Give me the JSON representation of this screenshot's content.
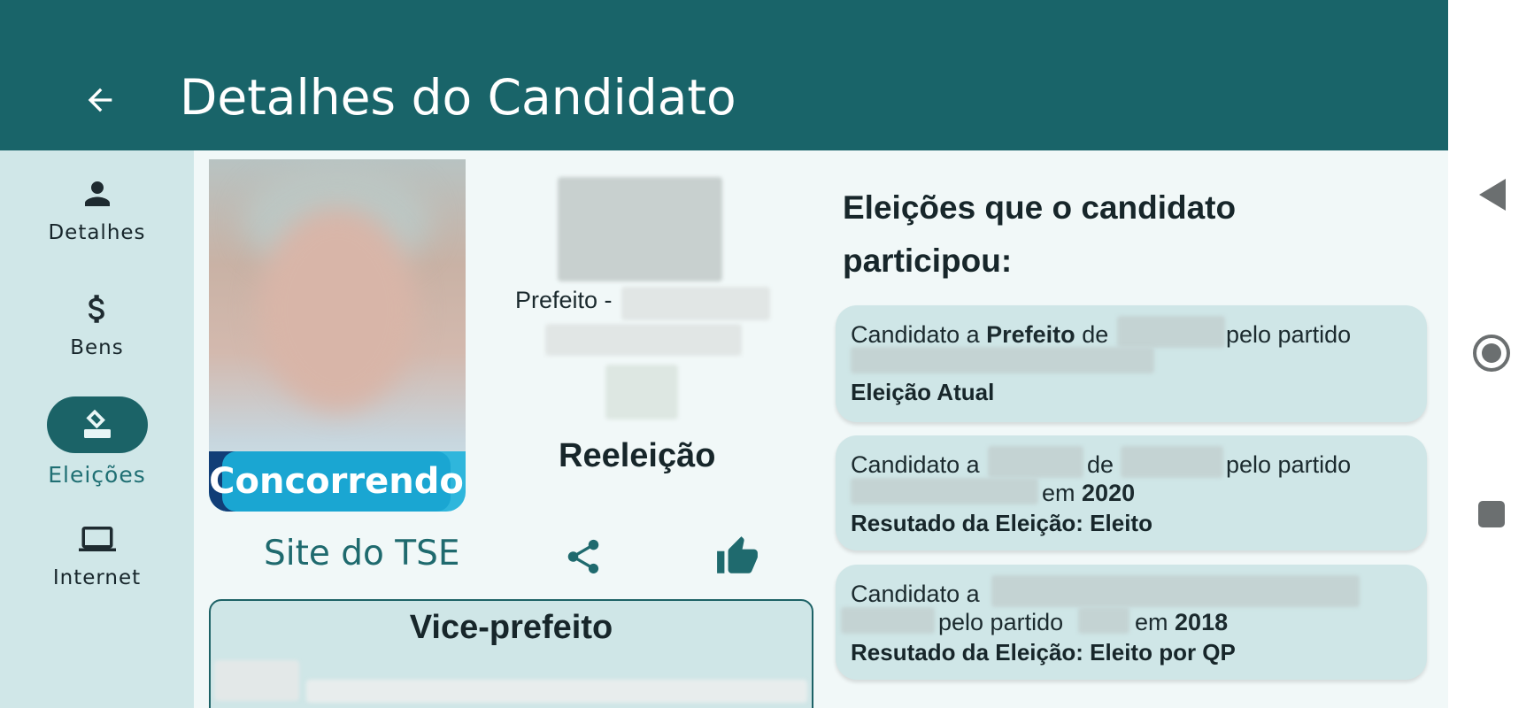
{
  "app_bar": {
    "title": "Detalhes do Candidato",
    "back_icon": "arrow-left-icon",
    "background": "#196469"
  },
  "nav_rail": {
    "items": [
      {
        "label": "Detalhes",
        "icon": "person-icon",
        "active": false
      },
      {
        "label": "Bens",
        "icon": "dollar-icon",
        "active": false
      },
      {
        "label": "Eleições",
        "icon": "ballot-box-icon",
        "active": true
      },
      {
        "label": "Internet",
        "icon": "laptop-icon",
        "active": false
      }
    ]
  },
  "candidate": {
    "status_badge": "Concorrendo",
    "office_prefix": "Prefeito -",
    "reelection": "Reeleição",
    "site_link": "Site do TSE",
    "share_icon": "share-icon",
    "like_icon": "thumbs-up-icon",
    "vice_title": "Vice-prefeito"
  },
  "elections": {
    "heading": "Eleições que o candidato participou:",
    "cards": [
      {
        "l1_pre": "Candidato a",
        "l1_office": "Prefeito",
        "l1_mid": "de",
        "l1_post": "pelo partido",
        "status": "Eleição Atual"
      },
      {
        "l1_pre": "Candidato a",
        "l1_mid": "de",
        "l1_post": "pelo partido",
        "l2_em": "em",
        "year": "2020",
        "result": "Resutado da Eleição: Eleito"
      },
      {
        "l1_pre": "Candidato a",
        "l2_mid": "pelo partido",
        "l2_em": "em",
        "year": "2018",
        "result": "Resutado da Eleição: Eleito por QP"
      }
    ]
  },
  "system_nav": {
    "back": "triangle-back-icon",
    "home": "circle-home-icon",
    "recents": "square-recents-icon"
  }
}
